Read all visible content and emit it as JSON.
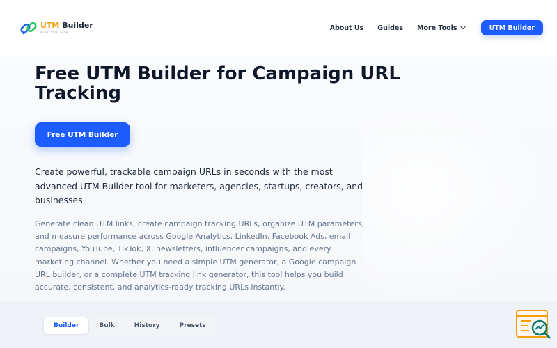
{
  "header": {
    "logo": {
      "title_prefix": "UTM",
      "title_suffix": " Builder",
      "tagline": "Build. Track. Grow."
    },
    "nav": {
      "about": "About Us",
      "guides": "Guides",
      "more_tools": "More Tools",
      "cta": "UTM Builder"
    }
  },
  "hero": {
    "title": "Free UTM Builder for Campaign URL Tracking",
    "cta": "Free UTM Builder",
    "lead": "Create powerful, trackable campaign URLs in seconds with the most advanced UTM Builder tool for marketers, agencies, startups, creators, and businesses.",
    "description": "Generate clean UTM links, create campaign tracking URLs, organize UTM parameters, and measure performance across Google Analytics, LinkedIn, Facebook Ads, email campaigns, YouTube, TikTok, X, newsletters, influencer campaigns, and every marketing channel. Whether you need a simple UTM generator, a Google campaign URL builder, or a complete UTM tracking link generator, this tool helps you build accurate, consistent, and analytics-ready tracking URLs instantly."
  },
  "tabs": [
    {
      "label": "Builder",
      "active": true
    },
    {
      "label": "Bulk",
      "active": false
    },
    {
      "label": "History",
      "active": false
    },
    {
      "label": "Presets",
      "active": false
    }
  ],
  "icons": {
    "logo": "chain-link-icon",
    "chevron": "chevron-down-icon",
    "widget": "search-analytics-icon"
  },
  "colors": {
    "primary": "#1d5cff",
    "logo_accent": "#f59e0b",
    "logo_blue": "#2563eb",
    "logo_green": "#22c55e",
    "widget_orange": "#f59e0b",
    "widget_teal": "#0f766e"
  }
}
